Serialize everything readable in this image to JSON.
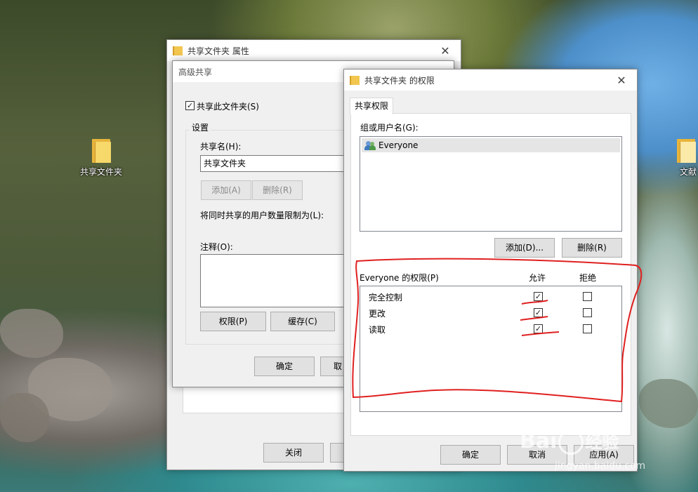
{
  "desktop": {
    "left_icon_label": "共享文件夹",
    "right_icon_label": "文献"
  },
  "properties_window": {
    "title": "共享文件夹 属性",
    "close_glyph": "✕",
    "close_label": "关闭"
  },
  "advanced_sharing": {
    "title": "高级共享",
    "share_checkbox_label": "共享此文件夹(S)",
    "share_checked": "✓",
    "settings_group": "设置",
    "share_name_label": "共享名(H):",
    "share_name_value": "共享文件夹",
    "add_label": "添加(A)",
    "remove_label": "删除(R)",
    "user_limit_label": "将同时共享的用户数量限制为(L):",
    "comment_label": "注释(O):",
    "permissions_label": "权限(P)",
    "cache_label": "缓存(C)",
    "ok_label": "确定",
    "cancel_partial": "取"
  },
  "permissions_dialog": {
    "title": "共享文件夹 的权限",
    "close_glyph": "✕",
    "tab_label": "共享权限",
    "groups_label": "组或用户名(G):",
    "users": [
      "Everyone"
    ],
    "add_label": "添加(D)...",
    "remove_label": "删除(R)",
    "perm_header": "Everyone 的权限(P)",
    "allow_header": "允许",
    "deny_header": "拒绝",
    "permissions": [
      {
        "name": "完全控制",
        "allow": "✓",
        "deny": ""
      },
      {
        "name": "更改",
        "allow": "✓",
        "deny": ""
      },
      {
        "name": "读取",
        "allow": "✓",
        "deny": ""
      }
    ],
    "ok_label": "确定",
    "cancel_label": "取消",
    "apply_label": "应用(A)"
  },
  "watermark": {
    "brand": "Bai",
    "brand_suffix": "经验",
    "url": "jingyan.baidu.com"
  },
  "annotation_color": "#e02020"
}
